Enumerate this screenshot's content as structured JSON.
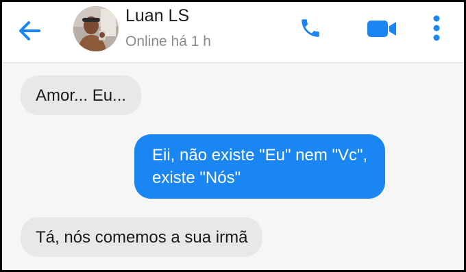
{
  "header": {
    "contact_name": "Luan LS",
    "status": "Online há 1 h",
    "accent_color": "#1a86f2",
    "icons": {
      "back": "back-arrow-icon",
      "call": "phone-icon",
      "video": "video-camera-icon",
      "more": "more-vertical-icon"
    }
  },
  "messages": [
    {
      "direction": "incoming",
      "lines": [
        "Amor... Eu..."
      ]
    },
    {
      "direction": "outgoing",
      "lines": [
        "Eii, não existe \"Eu\" nem \"Vc\",",
        "existe \"Nós\""
      ]
    },
    {
      "direction": "incoming",
      "lines": [
        "Tá, nós comemos a sua irmã"
      ]
    }
  ]
}
